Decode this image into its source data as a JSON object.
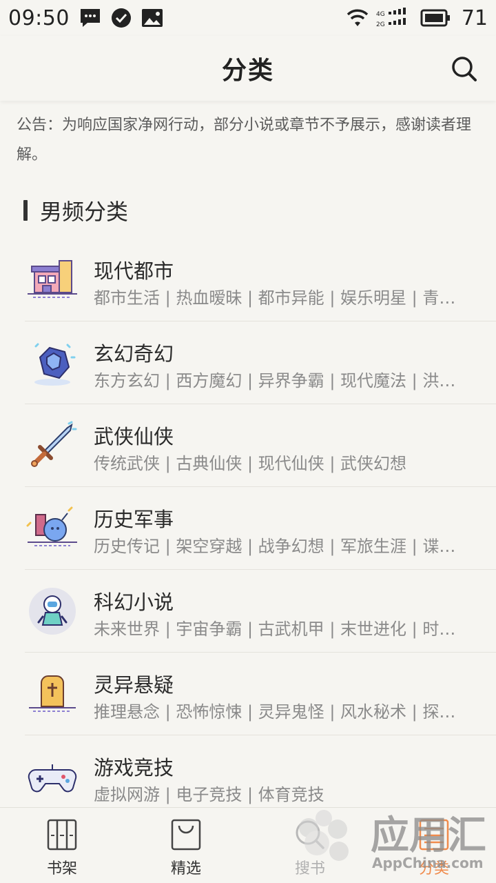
{
  "status_bar": {
    "time": "09:50",
    "battery": "71",
    "network_4g": "4G",
    "network_2g": "2G",
    "icons": [
      "message-icon",
      "check-circle-icon",
      "image-icon",
      "wifi-icon",
      "signal-icon",
      "battery-icon"
    ]
  },
  "header": {
    "title": "分类"
  },
  "notice": {
    "text": "公告：为响应国家净网行动，部分小说或章节不予展示，感谢读者理解。"
  },
  "section": {
    "title": "男频分类"
  },
  "categories": [
    {
      "title": "现代都市",
      "sub": "都市生活 | 热血暧昧 | 都市异能 | 娱乐明星 | 青…",
      "icon": "city-building-icon"
    },
    {
      "title": "玄幻奇幻",
      "sub": "东方玄幻 | 西方魔幻 | 异界争霸 | 现代魔法 | 洪…",
      "icon": "crystal-gem-icon"
    },
    {
      "title": "武侠仙侠",
      "sub": "传统武侠 | 古典仙侠 | 现代仙侠 | 武侠幻想",
      "icon": "sword-icon"
    },
    {
      "title": "历史军事",
      "sub": "历史传记 | 架空穿越 | 战争幻想 | 军旅生涯 | 谍…",
      "icon": "bomb-icon"
    },
    {
      "title": "科幻小说",
      "sub": "未来世界 | 宇宙争霸 | 古武机甲 | 末世进化 | 时…",
      "icon": "astronaut-icon"
    },
    {
      "title": "灵异悬疑",
      "sub": "推理悬念 | 恐怖惊悚 | 灵异鬼怪 | 风水秘术 | 探…",
      "icon": "tombstone-icon"
    },
    {
      "title": "游戏竞技",
      "sub": "虚拟网游 | 电子竞技 | 体育竞技",
      "icon": "gamepad-icon"
    }
  ],
  "bottom_nav": [
    {
      "label": "书架",
      "icon": "bookshelf-icon",
      "active": false
    },
    {
      "label": "精选",
      "icon": "shopping-bag-icon",
      "active": false
    },
    {
      "label": "搜书",
      "icon": "search-book-icon",
      "active": false
    },
    {
      "label": "分类",
      "icon": "category-icon",
      "active": true
    }
  ],
  "watermark": {
    "text": "应用汇",
    "sub": "AppChina.com"
  },
  "colors": {
    "accent": "#f08a4b",
    "background": "#f6f5f1"
  }
}
